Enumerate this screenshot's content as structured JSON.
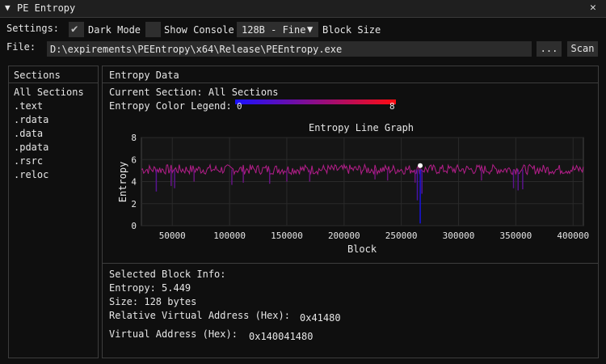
{
  "window": {
    "title": "PE Entropy",
    "collapse_icon": "triangle-down-icon",
    "close_icon": "close-icon"
  },
  "settings": {
    "label": "Settings:",
    "dark_mode_label": "Dark Mode",
    "dark_mode_checked": true,
    "show_console_label": "Show Console",
    "show_console_checked": false,
    "block_size_value": "128B - Fine",
    "block_size_label": "Block Size"
  },
  "file": {
    "label": "File:",
    "path": "D:\\expirements\\PEEntropy\\x64\\Release\\PEEntropy.exe",
    "browse_label": "...",
    "scan_label": "Scan"
  },
  "sections": {
    "title": "Sections",
    "items": [
      "All Sections",
      ".text",
      ".rdata",
      ".data",
      ".pdata",
      ".rsrc",
      ".reloc"
    ]
  },
  "entropy": {
    "title": "Entropy Data",
    "current_section_label": "Current Section: All Sections",
    "legend_label": "Entropy Color Legend:",
    "legend_min": "0",
    "legend_max": "8",
    "colors": {
      "low": "#1a10ff",
      "high": "#ff0b10",
      "line": "#b41e8a"
    }
  },
  "chart_data": {
    "type": "line",
    "title": "Entropy Line Graph",
    "xlabel": "Block",
    "ylabel": "Entropy",
    "xlim": [
      23000,
      409000
    ],
    "ylim": [
      0,
      8
    ],
    "x_ticks": [
      "50000",
      "100000",
      "150000",
      "200000",
      "250000",
      "300000",
      "350000",
      "400000"
    ],
    "y_ticks": [
      "0",
      "2",
      "4",
      "6",
      "8"
    ],
    "grid": true,
    "baseline": 5.1,
    "dips": [
      {
        "x": 36000,
        "y": 3.1
      },
      {
        "x": 49000,
        "y": 3.6
      },
      {
        "x": 52000,
        "y": 3.4
      },
      {
        "x": 69000,
        "y": 4.0
      },
      {
        "x": 102000,
        "y": 3.7
      },
      {
        "x": 112000,
        "y": 3.9
      },
      {
        "x": 135000,
        "y": 3.8
      },
      {
        "x": 150000,
        "y": 4.0
      },
      {
        "x": 170000,
        "y": 4.0
      },
      {
        "x": 227000,
        "y": 4.2
      },
      {
        "x": 238000,
        "y": 4.1
      },
      {
        "x": 262000,
        "y": 3.9
      },
      {
        "x": 264000,
        "y": 2.3
      },
      {
        "x": 266500,
        "y": 0.2
      },
      {
        "x": 268000,
        "y": 2.9
      },
      {
        "x": 320000,
        "y": 4.1
      },
      {
        "x": 348000,
        "y": 3.4
      },
      {
        "x": 352000,
        "y": 3.2
      },
      {
        "x": 356000,
        "y": 3.3
      }
    ],
    "selected_point": {
      "x": 266500,
      "y": 5.449
    }
  },
  "block_info": {
    "title": "Selected Block Info:",
    "entropy": "Entropy: 5.449",
    "size": "Size: 128 bytes",
    "rva_label": "Relative Virtual Address (Hex):",
    "rva_value": "0x41480",
    "va_label": "Virtual Address (Hex):",
    "va_value": "0x140041480"
  }
}
